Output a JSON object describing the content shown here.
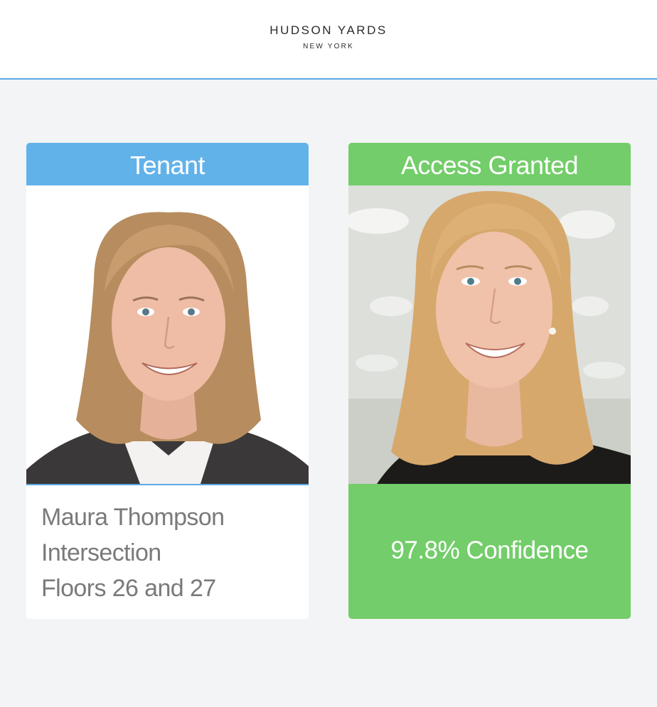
{
  "header": {
    "brand_name": "HUDSON YARDS",
    "brand_location": "NEW YORK",
    "accent_color": "#5aa9e6"
  },
  "tenant_card": {
    "title": "Tenant",
    "title_color": "#62b2ea",
    "photo_icon": "tenant-portrait",
    "name": "Maura Thompson",
    "company": "Intersection",
    "floors": "Floors 26 and 27"
  },
  "access_card": {
    "title": "Access Granted",
    "status_color": "#73cd6a",
    "photo_icon": "live-capture-portrait",
    "confidence": "97.8% Confidence"
  }
}
